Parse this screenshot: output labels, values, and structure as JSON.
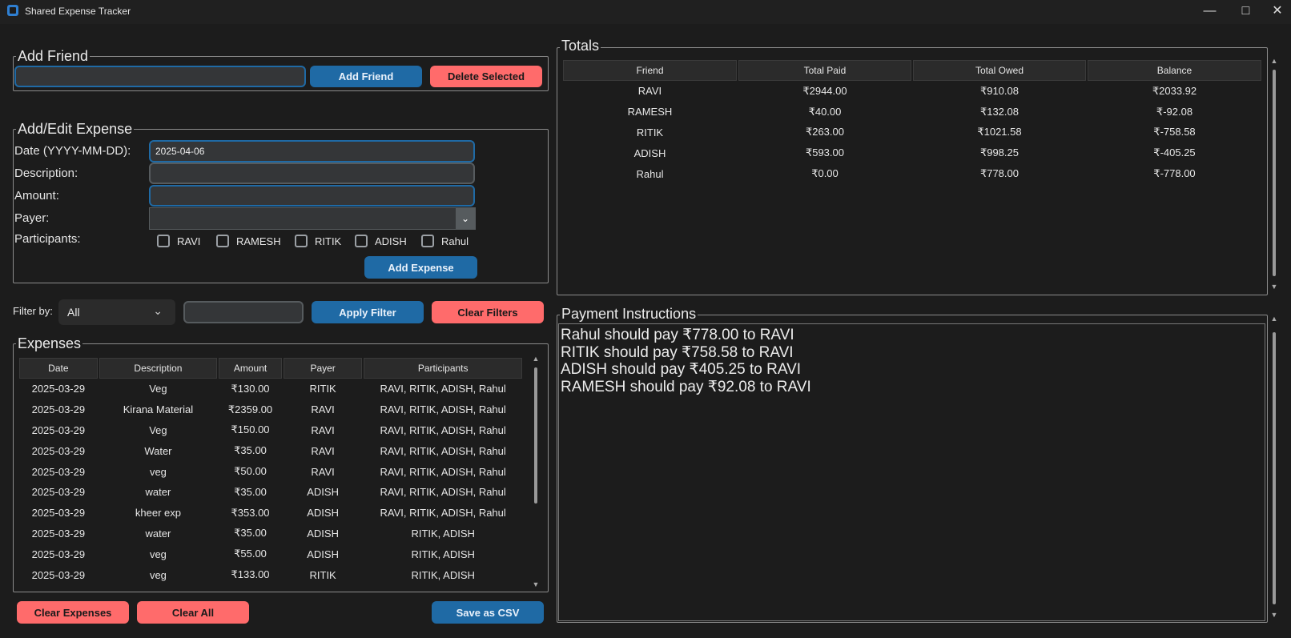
{
  "window": {
    "title": "Shared Expense Tracker"
  },
  "add_friend": {
    "legend": "Add Friend",
    "name_value": "",
    "add_label": "Add Friend",
    "delete_label": "Delete Selected"
  },
  "expense_form": {
    "legend": "Add/Edit Expense",
    "date_label": "Date (YYYY-MM-DD):",
    "date_value": "2025-04-06",
    "description_label": "Description:",
    "description_value": "",
    "amount_label": "Amount:",
    "amount_value": "",
    "payer_label": "Payer:",
    "payer_value": "",
    "participants_label": "Participants:",
    "participants": [
      "RAVI",
      "RAMESH",
      "RITIK",
      "ADISH",
      "Rahul"
    ],
    "add_label": "Add Expense"
  },
  "filter": {
    "label": "Filter by:",
    "selected": "All",
    "value": "",
    "apply_label": "Apply Filter",
    "clear_label": "Clear Filters"
  },
  "expenses": {
    "legend": "Expenses",
    "columns": [
      "Date",
      "Description",
      "Amount",
      "Payer",
      "Participants"
    ],
    "rows": [
      [
        "2025-03-29",
        "Veg",
        "₹130.00",
        "RITIK",
        "RAVI, RITIK, ADISH, Rahul"
      ],
      [
        "2025-03-29",
        "Kirana Material",
        "₹2359.00",
        "RAVI",
        "RAVI, RITIK, ADISH, Rahul"
      ],
      [
        "2025-03-29",
        "Veg",
        "₹150.00",
        "RAVI",
        "RAVI, RITIK, ADISH, Rahul"
      ],
      [
        "2025-03-29",
        "Water",
        "₹35.00",
        "RAVI",
        "RAVI, RITIK, ADISH, Rahul"
      ],
      [
        "2025-03-29",
        "veg",
        "₹50.00",
        "RAVI",
        "RAVI, RITIK, ADISH, Rahul"
      ],
      [
        "2025-03-29",
        "water",
        "₹35.00",
        "ADISH",
        "RAVI, RITIK, ADISH, Rahul"
      ],
      [
        "2025-03-29",
        "kheer exp",
        "₹353.00",
        "ADISH",
        "RAVI, RITIK, ADISH, Rahul"
      ],
      [
        "2025-03-29",
        "water",
        "₹35.00",
        "ADISH",
        "RITIK, ADISH"
      ],
      [
        "2025-03-29",
        "veg",
        "₹55.00",
        "ADISH",
        "RITIK, ADISH"
      ],
      [
        "2025-03-29",
        "veg",
        "₹133.00",
        "RITIK",
        "RITIK, ADISH"
      ]
    ]
  },
  "bottom_buttons": {
    "clear_expenses": "Clear Expenses",
    "clear_all": "Clear All",
    "save_csv": "Save as CSV"
  },
  "totals": {
    "legend": "Totals",
    "columns": [
      "Friend",
      "Total Paid",
      "Total Owed",
      "Balance"
    ],
    "rows": [
      [
        "RAVI",
        "₹2944.00",
        "₹910.08",
        "₹2033.92"
      ],
      [
        "RAMESH",
        "₹40.00",
        "₹132.08",
        "₹-92.08"
      ],
      [
        "RITIK",
        "₹263.00",
        "₹1021.58",
        "₹-758.58"
      ],
      [
        "ADISH",
        "₹593.00",
        "₹998.25",
        "₹-405.25"
      ],
      [
        "Rahul",
        "₹0.00",
        "₹778.00",
        "₹-778.00"
      ]
    ]
  },
  "payment_instructions": {
    "legend": "Payment Instructions",
    "lines": [
      "Rahul should pay ₹778.00 to RAVI",
      "RITIK should pay ₹758.58 to RAVI",
      "ADISH should pay ₹405.25 to RAVI",
      "RAMESH should pay ₹92.08 to RAVI"
    ]
  }
}
